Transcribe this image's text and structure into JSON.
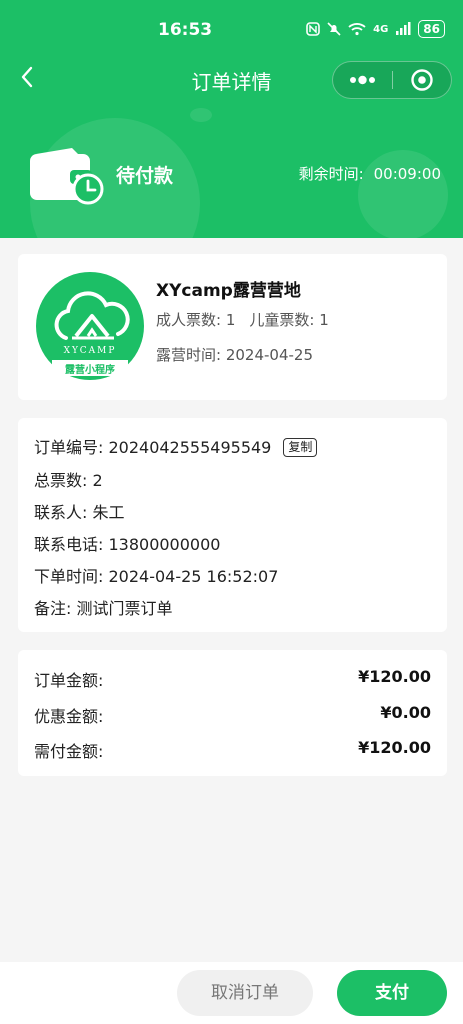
{
  "status_bar": {
    "time": "16:53",
    "network": "4G",
    "battery": "86"
  },
  "nav": {
    "title": "订单详情"
  },
  "order_status": {
    "label": "待付款",
    "remain_label": "剩余时间:",
    "remain_value": "00:09:00"
  },
  "camp": {
    "name": "XYcamp露营营地",
    "logo_text_top": "XYCAMP",
    "logo_text_bottom": "露营小程序",
    "adult_tickets": "成人票数: 1",
    "child_tickets": "儿童票数: 1",
    "camp_time": "露营时间: 2024-04-25"
  },
  "details": {
    "order_no": "订单编号: 2024042555495549",
    "copy_label": "复制",
    "total_tickets": "总票数: 2",
    "contact": "联系人: 朱工",
    "phone": "联系电话: 13800000000",
    "order_time": "下单时间: 2024-04-25 16:52:07",
    "remark": "备注: 测试门票订单"
  },
  "amounts": [
    {
      "label": "订单金额:",
      "value": "¥120.00"
    },
    {
      "label": "优惠金额:",
      "value": "¥0.00"
    },
    {
      "label": "需付金额:",
      "value": "¥120.00"
    }
  ],
  "actions": {
    "cancel_label": "取消订单",
    "pay_label": "支付"
  },
  "colors": {
    "brand": "#1cbf66"
  }
}
